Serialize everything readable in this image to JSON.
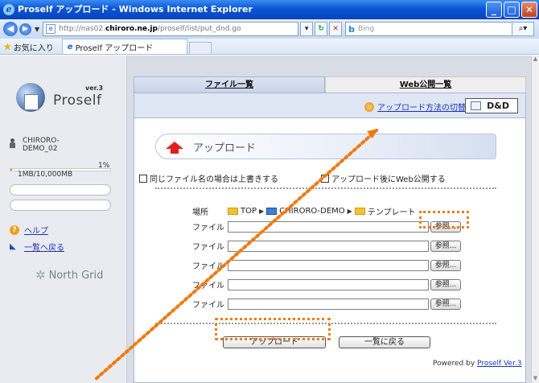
{
  "window": {
    "title": "Proself アップロード - Windows Internet Explorer",
    "buttons": [
      "_",
      "□",
      "✕"
    ]
  },
  "address_bar": {
    "url_prefix": "http://nas02.",
    "url_host": "chiroro.ne.jp",
    "url_path": "/proself/list/put_dnd.go",
    "search_placeholder": "Bing"
  },
  "favorites_bar": {
    "favorites_label": "お気に入り",
    "active_tab": "Proself アップロード"
  },
  "sidebar": {
    "logo_name": "Proself",
    "logo_version": "ver.3",
    "host_line1": "CHIRORO-",
    "host_line2": "DEMO_02",
    "quota_percent": "1%",
    "quota_fraction": 0.01,
    "quota_text": "1MB/10,000MB",
    "help_link": "ヘルプ",
    "back_link": "一覧へ戻る",
    "brand": "North Grid"
  },
  "tabs": {
    "file_list": "ファイル一覧",
    "web_public_list": "Web公開一覧"
  },
  "toolbar": {
    "switch_method_link": "アップロード方法の切替",
    "dnd_button": "D&D"
  },
  "upload": {
    "heading": "アップロード",
    "overwrite_option": "同じファイル名の場合は上書きする",
    "web_publish_option": "アップロード後にWeb公開する",
    "location_label": "場所",
    "breadcrumb": [
      "TOP",
      "CHIRORO-DEMO",
      "テンプレート"
    ],
    "file_label": "ファイル",
    "browse_label": "参照...",
    "upload_button": "アップロード",
    "back_button": "一覧に戻る"
  },
  "footer": {
    "powered_prefix": "Powered by",
    "powered_link": "Proself Ver.3"
  },
  "colors": {
    "highlight": "#f07a10",
    "link": "#1b33b5",
    "titlebar": "#0a55d6"
  }
}
